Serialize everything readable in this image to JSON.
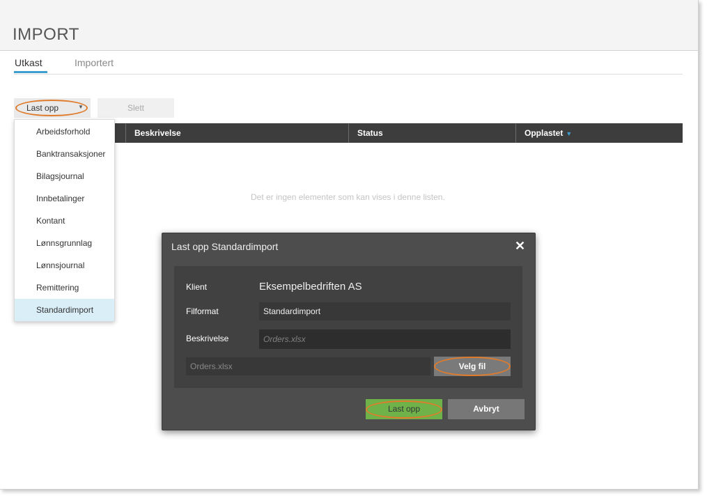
{
  "page": {
    "title": "IMPORT"
  },
  "tabs": [
    {
      "label": "Utkast",
      "active": true
    },
    {
      "label": "Importert",
      "active": false
    }
  ],
  "toolbar": {
    "upload_label": "Last opp",
    "upload_caret_icon": "caret-down-icon",
    "delete_label": "Slett"
  },
  "table": {
    "columns": [
      "Beskrivelse",
      "Status",
      "Opplastet"
    ],
    "sort_column": "Opplastet",
    "sort_direction": "descending",
    "empty_message": "Det er ingen elementer som kan vises i denne listen."
  },
  "dropdown": {
    "items": [
      "Arbeidsforhold",
      "Banktransaksjoner",
      "Bilagsjournal",
      "Innbetalinger",
      "Kontant",
      "Lønnsgrunnlag",
      "Lønnsjournal",
      "Remittering",
      "Standardimport"
    ],
    "selected": "Standardimport"
  },
  "modal": {
    "title": "Last opp Standardimport",
    "close_icon": "close-icon",
    "klient_label": "Klient",
    "klient_value": "Eksempelbedriften AS",
    "filformat_label": "Filformat",
    "filformat_value": "Standardimport",
    "beskrivelse_label": "Beskrivelse",
    "beskrivelse_placeholder": "Orders.xlsx",
    "file_name": "Orders.xlsx",
    "choose_file_label": "Velg fil",
    "submit_label": "Last opp",
    "cancel_label": "Avbryt"
  },
  "colors": {
    "accent": "#3c9fd0",
    "highlight_oval": "#e07b2b",
    "submit_green": "#6fb24a",
    "table_header_bg": "#3d3d3d",
    "modal_bg": "#4d4d4d"
  }
}
